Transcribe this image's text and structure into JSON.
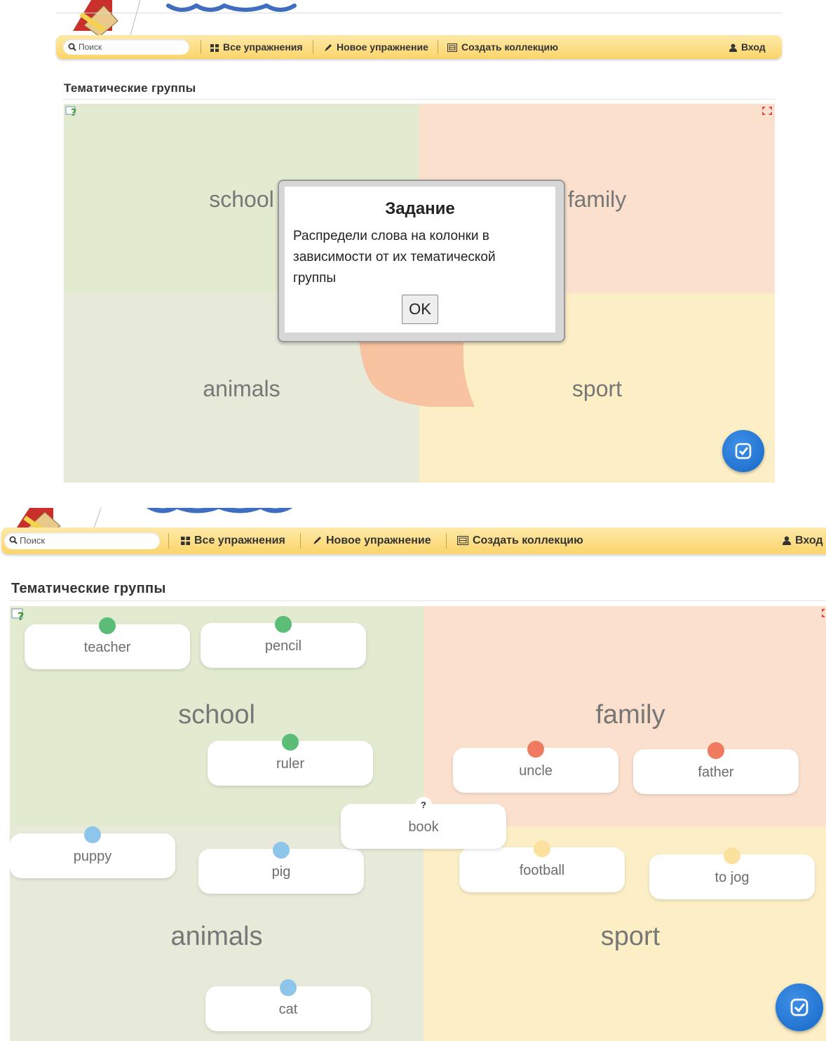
{
  "nav": {
    "search_placeholder": "Поиск",
    "all_exercises": "Все упражнения",
    "new_exercise": "Новое упражнение",
    "create_collection": "Создать коллекцию",
    "login": "Вход"
  },
  "page_title": "Тематические группы",
  "groups": {
    "school": "school",
    "family": "family",
    "animals": "animals",
    "sport": "sport"
  },
  "dialog": {
    "title": "Задание",
    "text": "Распредели слова на колонки в зависимости от их тематической группы",
    "ok_label": "OK"
  },
  "cards": {
    "teacher": "teacher",
    "pencil": "pencil",
    "ruler": "ruler",
    "uncle": "uncle",
    "father": "father",
    "book": "book",
    "book_marker": "?",
    "puppy": "puppy",
    "pig": "pig",
    "football": "football",
    "to_jog": "to jog",
    "cat": "cat"
  },
  "colors": {
    "navbar": "#fbd56a",
    "school": "#e2ebd0",
    "family": "#fbe0cd",
    "animals": "#e7ead9",
    "sport": "#fcefc5",
    "check_button": "#1769c8"
  },
  "icons": [
    "search-icon",
    "grid-icon",
    "pencil-icon",
    "collection-icon",
    "user-icon",
    "help-icon",
    "fullscreen-icon",
    "check-icon"
  ]
}
